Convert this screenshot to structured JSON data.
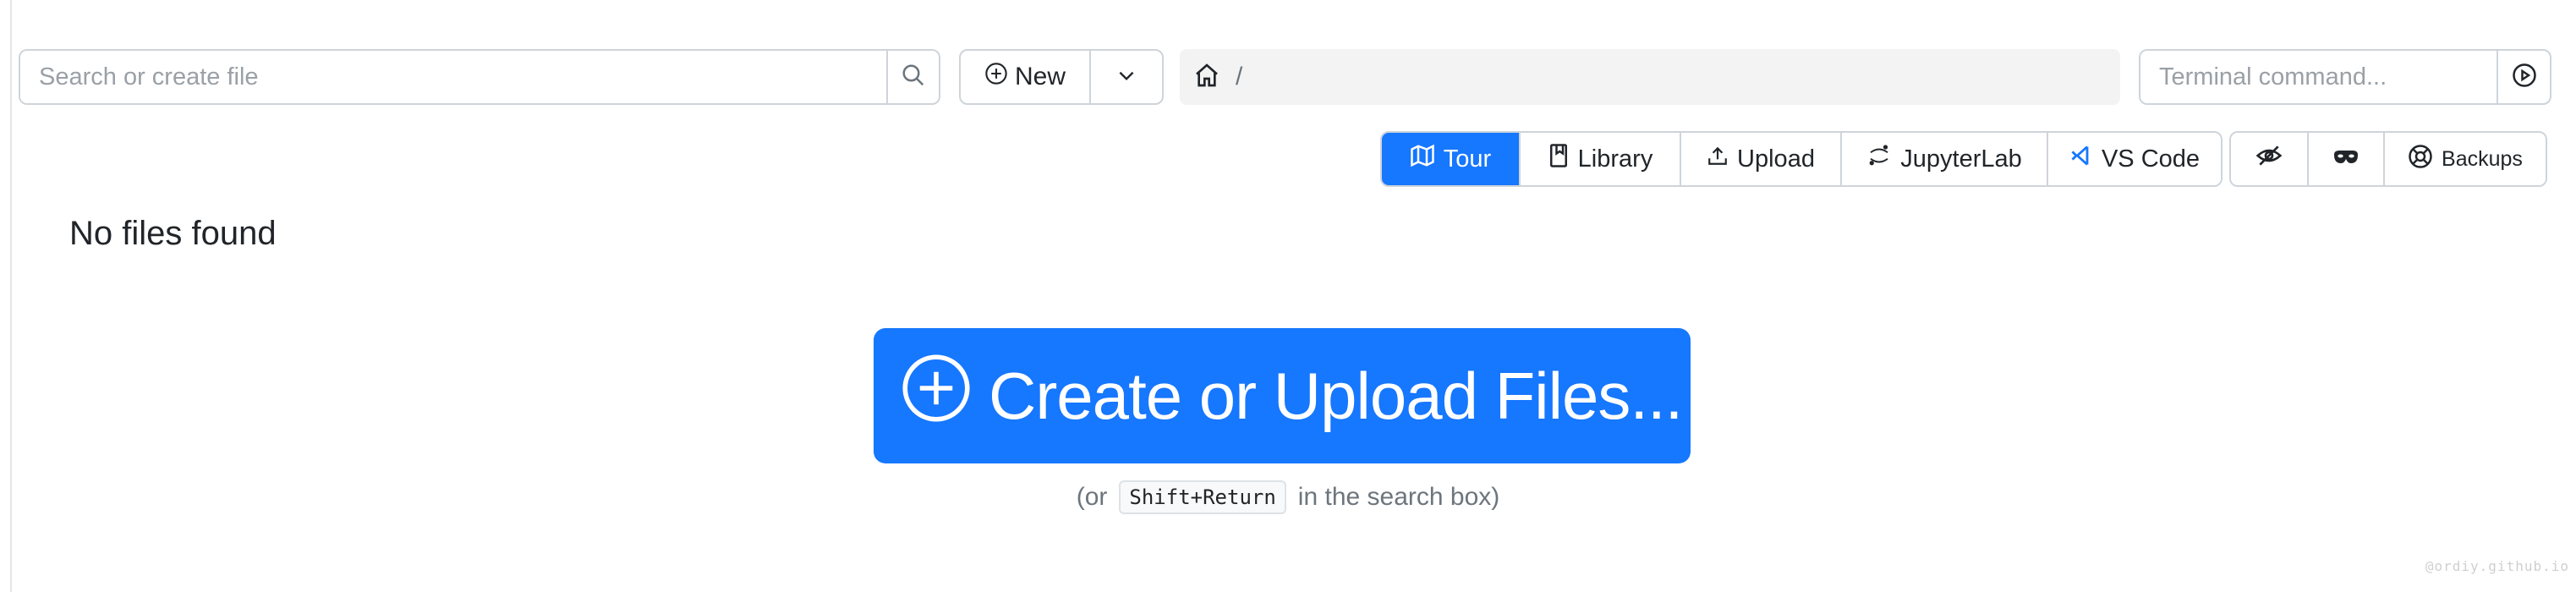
{
  "search": {
    "placeholder": "Search or create file"
  },
  "new_menu": {
    "label": "New"
  },
  "path": {
    "separator": "/"
  },
  "terminal": {
    "placeholder": "Terminal command..."
  },
  "toolbar": {
    "buttons": [
      {
        "label": "Tour",
        "icon": "map-icon"
      },
      {
        "label": "Library",
        "icon": "book-icon"
      },
      {
        "label": "Upload",
        "icon": "upload-icon"
      },
      {
        "label": "JupyterLab",
        "icon": "jupyter-icon"
      },
      {
        "label": "VS Code",
        "icon": "vscode-icon"
      }
    ],
    "right_buttons": [
      {
        "icon": "hidden-files-icon"
      },
      {
        "icon": "mask-icon"
      },
      {
        "label": "Backups",
        "icon": "lifebuoy-icon"
      }
    ]
  },
  "main": {
    "empty_message": "No files found",
    "create_label": "Create or Upload Files...",
    "hint_prefix": "(or",
    "hint_key": "Shift+Return",
    "hint_suffix": "in the search box)"
  },
  "watermark": "@ordiy.github.io",
  "colors": {
    "primary": "#1677ff",
    "border": "#ced4da",
    "path_bg": "#f3f3f3"
  }
}
